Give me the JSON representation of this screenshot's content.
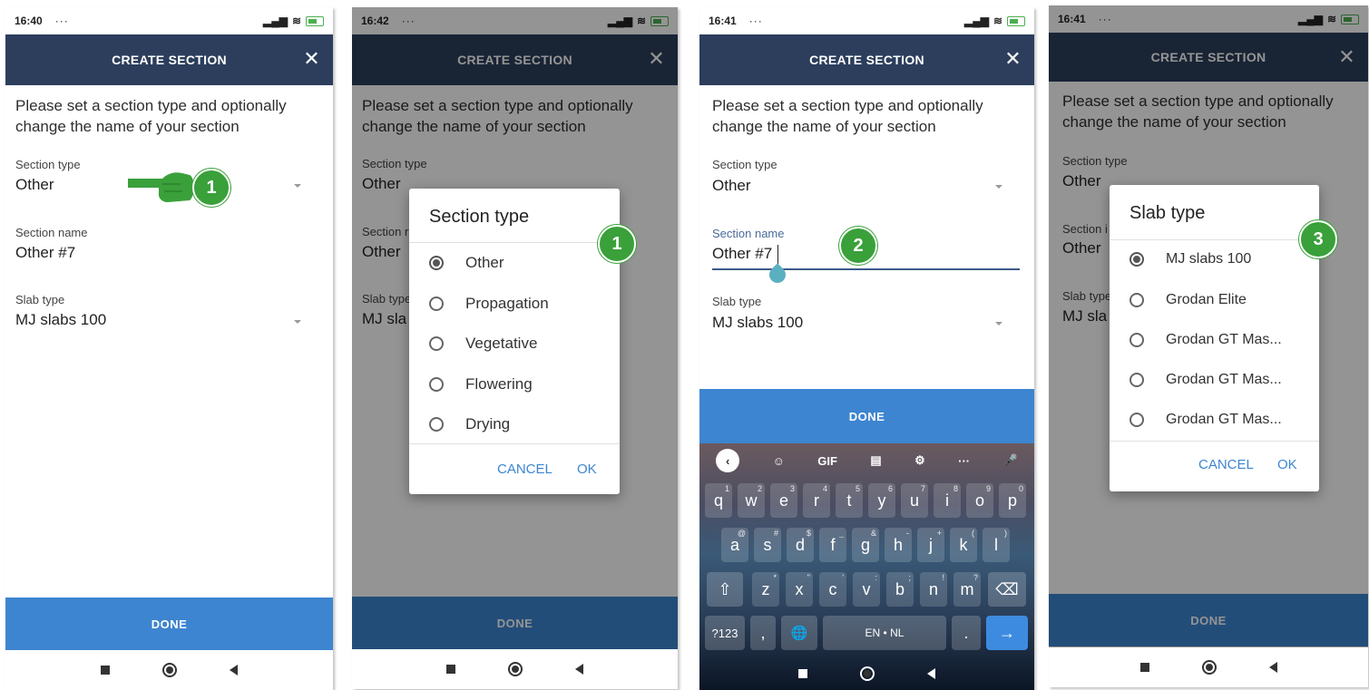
{
  "colors": {
    "header": "#2c3e5c",
    "done": "#3d85d0",
    "badge": "#3aa03a",
    "accent": "#3d85d0"
  },
  "common": {
    "header_title": "CREATE SECTION",
    "close": "✕",
    "intro": "Please set a section type and optionally change the name of your section",
    "section_type_label": "Section type",
    "section_type_value": "Other",
    "section_name_label": "Section name",
    "section_name_value": "Other #7",
    "slab_type_label": "Slab type",
    "slab_type_value": "MJ slabs 100",
    "done": "DONE",
    "dots": "···"
  },
  "screens": [
    {
      "time": "16:40",
      "badge": "1"
    },
    {
      "time": "16:42",
      "badge": "1",
      "dialog": {
        "title": "Section type",
        "options": [
          "Other",
          "Propagation",
          "Vegetative",
          "Flowering",
          "Drying"
        ],
        "selected": "Other",
        "cancel": "CANCEL",
        "ok": "OK"
      },
      "partial": {
        "section_name": "Section r",
        "section_value": "Other",
        "slab_label": "Slab type",
        "slab_value": "MJ sla"
      }
    },
    {
      "time": "16:41",
      "badge": "2",
      "keyboard": {
        "toolbar": [
          "‹",
          "☺",
          "GIF",
          "▤",
          "⚙",
          "···",
          "🎤"
        ],
        "row1": [
          "q",
          "w",
          "e",
          "r",
          "t",
          "y",
          "u",
          "i",
          "o",
          "p"
        ],
        "row1_hints": [
          "1",
          "2",
          "3",
          "4",
          "5",
          "6",
          "7",
          "8",
          "9",
          "0"
        ],
        "row2": [
          "a",
          "s",
          "d",
          "f",
          "g",
          "h",
          "j",
          "k",
          "l"
        ],
        "row2_hints": [
          "@",
          "#",
          "$",
          "_",
          "&",
          "-",
          "+",
          "(",
          ")"
        ],
        "row3": [
          "z",
          "x",
          "c",
          "v",
          "b",
          "n",
          "m"
        ],
        "row3_hints": [
          "*",
          "\"",
          "'",
          ":",
          ";",
          "!",
          "?"
        ],
        "shift": "⇧",
        "backspace": "⌫",
        "symbols": "?123",
        "comma": ",",
        "globe": "🌐",
        "space": "EN • NL",
        "period": ".",
        "enter": "→"
      }
    },
    {
      "time": "16:41",
      "badge": "3",
      "dialog": {
        "title": "Slab type",
        "options": [
          "MJ slabs 100",
          "Grodan Elite",
          "Grodan GT Mas...",
          "Grodan GT Mas...",
          "Grodan GT Mas..."
        ],
        "selected": "MJ slabs 100",
        "cancel": "CANCEL",
        "ok": "OK"
      },
      "partial": {
        "section_name": "Section i",
        "section_value": "Other",
        "slab_label": "Slab type",
        "slab_value": "MJ sla"
      }
    }
  ]
}
